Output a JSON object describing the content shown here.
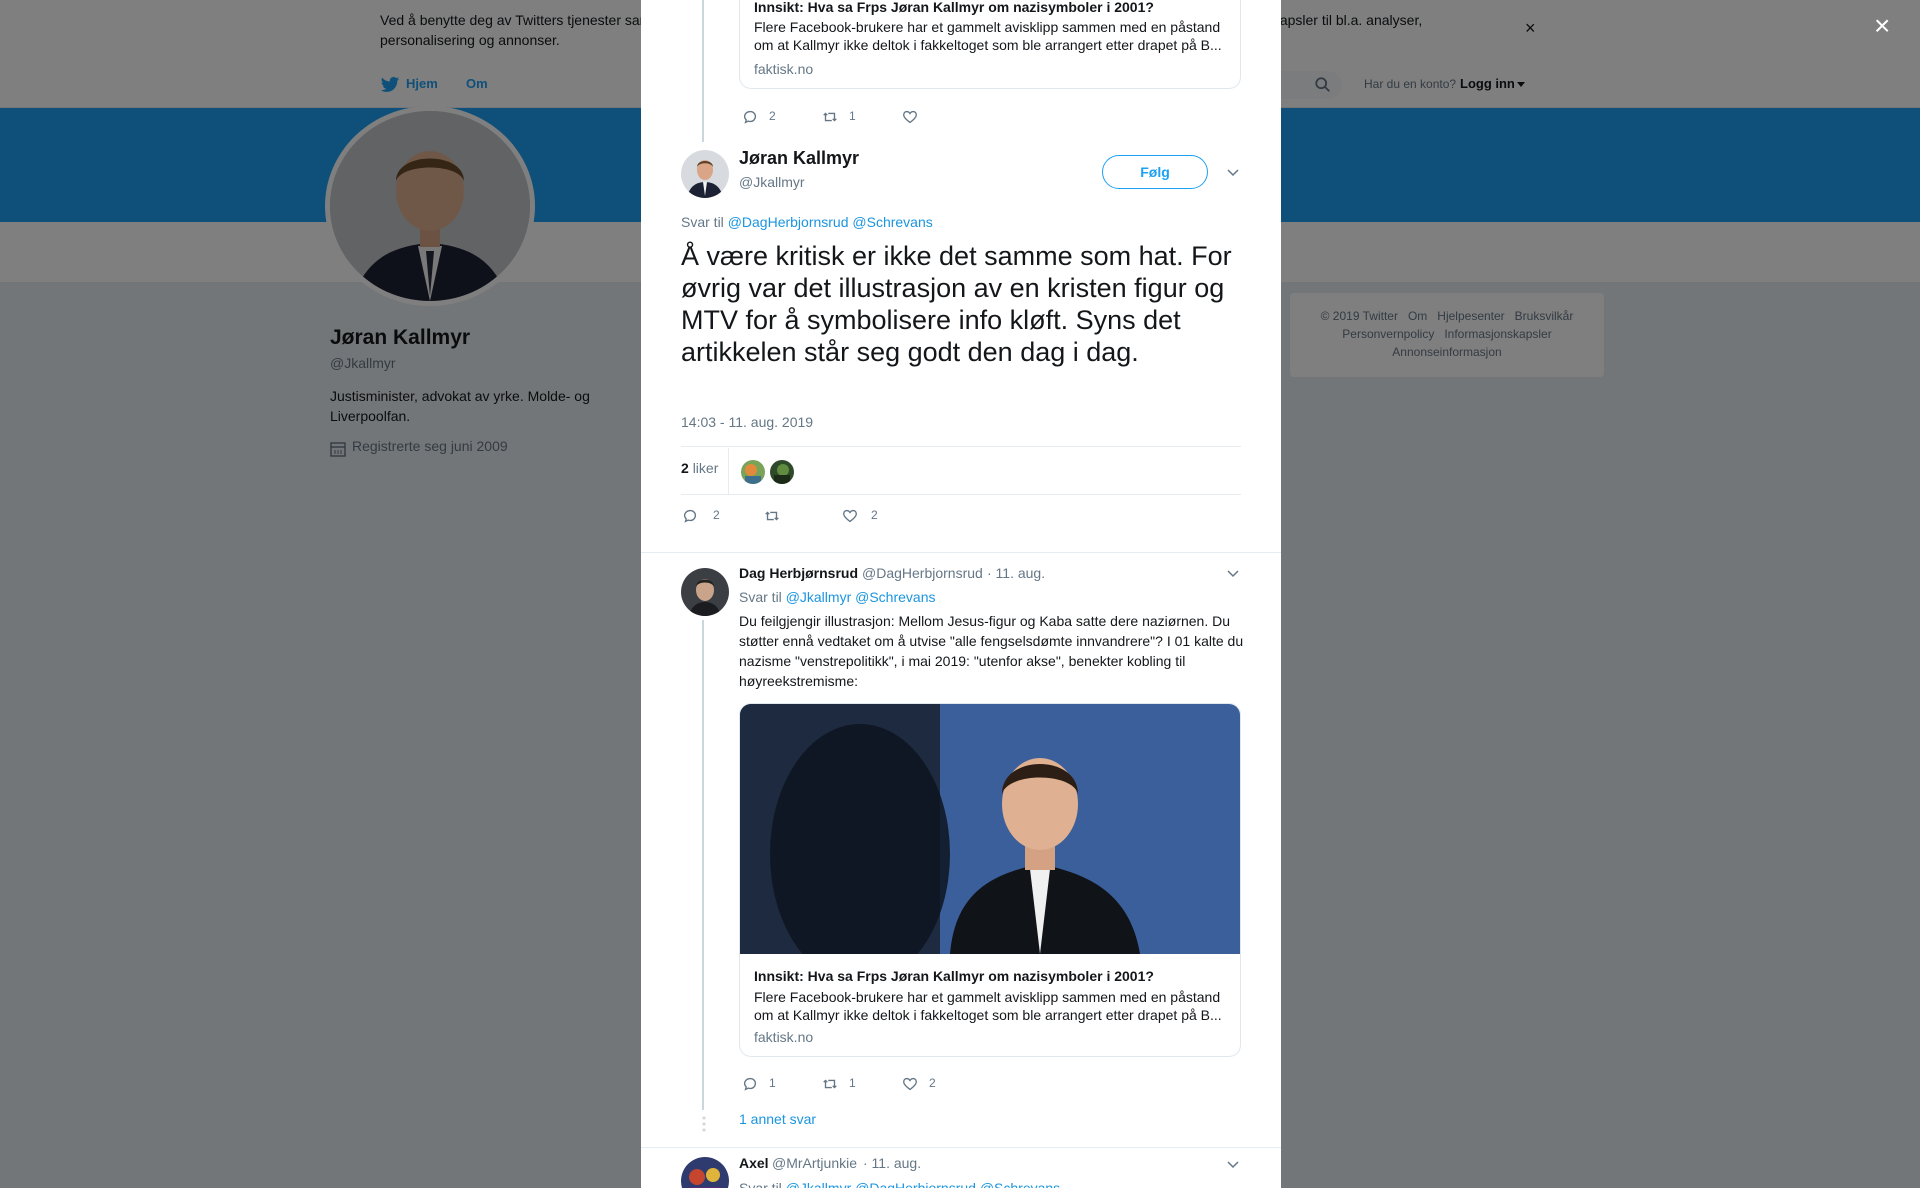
{
  "cookie": {
    "text": "Ved å benytte deg av Twitters tjenester samtykker du i vår bruk av informasjonskapsler. Vi og våre partnere driver globalt og bruker informasjonskapsler til bl.a. analyser, personalisering og annonser.",
    "close_label": "×"
  },
  "nav": {
    "home": "Hjem",
    "about": "Om",
    "account_question": "Har du en konto?",
    "login": "Logg inn"
  },
  "profile": {
    "name": "Jøran Kallmyr",
    "handle": "@Jkallmyr",
    "bio": "Justisminister, advokat av yrke. Molde- og Liverpoolfan.",
    "joined": "Registrerte seg juni 2009"
  },
  "footer": {
    "links": [
      "© 2019 Twitter",
      "Om",
      "Hjelpesenter",
      "Bruksvilkår",
      "Personvernpolicy",
      "Informasjonskapsler",
      "Annonseinformasjon"
    ]
  },
  "overlay": {
    "close_label": "×"
  },
  "top_card": {
    "title": "Innsikt: Hva sa Frps Jøran Kallmyr om nazisymboler i 2001?",
    "description": "Flere Facebook-brukere har et gammelt avisklipp sammen med en påstand om at Kallmyr ikke deltok i fakkeltoget som ble arrangert etter drapet på B...",
    "domain": "faktisk.no",
    "replies": "2",
    "retweets": "1",
    "likes": ""
  },
  "main_tweet": {
    "name": "Jøran Kallmyr",
    "handle": "@Jkallmyr",
    "follow_label": "Følg",
    "reply_prefix": "Svar til",
    "reply_to": "@DagHerbjornsrud @Schrevans",
    "text": "Å være kritisk er ikke det samme som hat. For øvrig var det illustrasjon av en kristen figur og MTV for å symbolisere info kløft. Syns det artikkelen står seg godt den dag i dag.",
    "timestamp": "14:03 - 11. aug. 2019",
    "likes_number": "2",
    "likes_word": "liker",
    "replies": "2",
    "retweets": "",
    "likes": "2"
  },
  "reply1": {
    "name": "Dag Herbjørnsrud",
    "handle": "@DagHerbjornsrud",
    "date": "· 11. aug.",
    "reply_prefix": "Svar til",
    "reply_to": "@Jkallmyr @Schrevans",
    "text": "Du feilgjengir illustrasjon: Mellom Jesus-figur og Kaba satte dere naziørnen. Du støtter ennå vedtaket om å utvise \"alle fengselsdømte innvandrere\"? I 01 kalte du nazisme \"venstrepolitikk\", i mai 2019: \"utenfor akse\", benekter kobling til høyreekstremisme:",
    "card_title": "Innsikt: Hva sa Frps Jøran Kallmyr om nazisymboler i 2001?",
    "card_description": "Flere Facebook-brukere har et gammelt avisklipp sammen med en påstand om at Kallmyr ikke deltok i fakkeltoget som ble arrangert etter drapet på B...",
    "card_domain": "faktisk.no",
    "replies": "1",
    "retweets": "1",
    "likes": "2",
    "more_replies": "1 annet svar"
  },
  "reply2": {
    "name": "Axel",
    "handle": "@MrArtjunkie",
    "date": "· 11. aug.",
    "reply_prefix": "Svar til",
    "reply_to": "@Jkallmyr @DagHerbjornsrud @Schrevans"
  },
  "colors": {
    "accent": "#1da1f2",
    "link": "#1b95e0",
    "muted": "#657786",
    "banner": "#1da1f2"
  },
  "icons": [
    "twitter-bird-icon",
    "search-icon",
    "calendar-icon",
    "reply-icon",
    "retweet-icon",
    "heart-icon",
    "chevron-down-icon",
    "close-icon"
  ]
}
